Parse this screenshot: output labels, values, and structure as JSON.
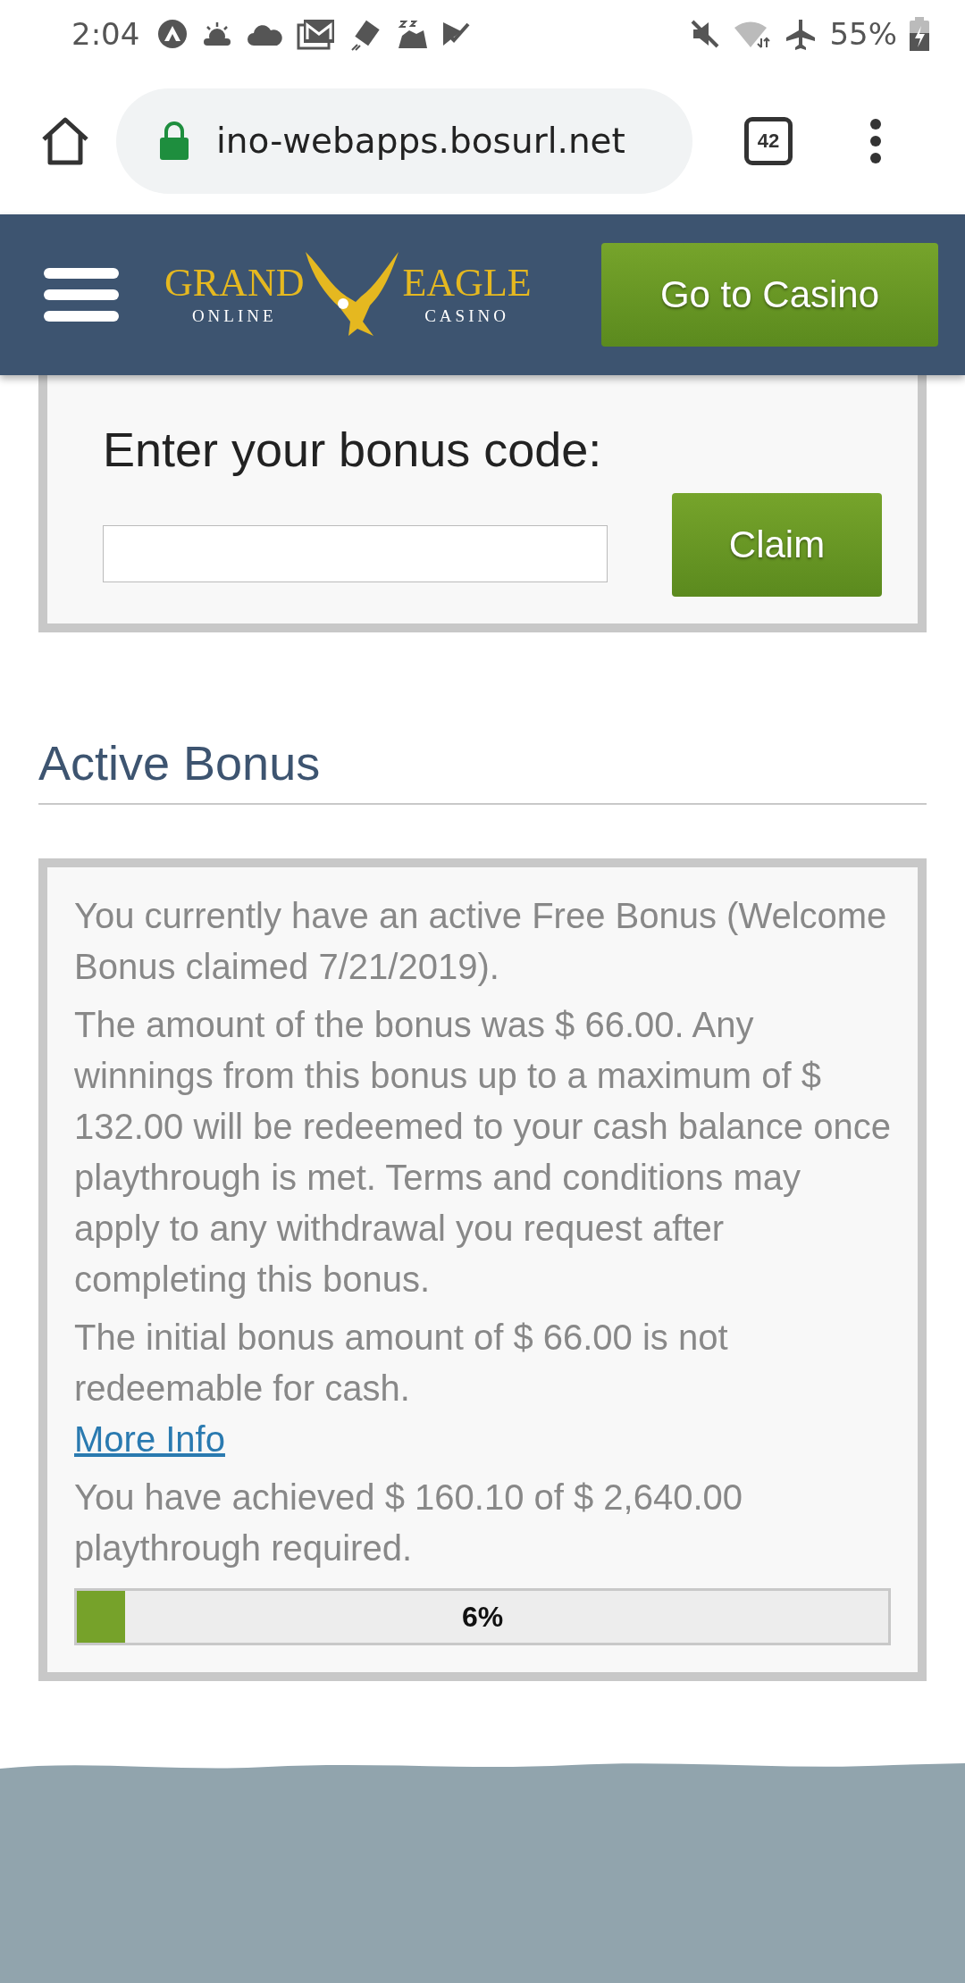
{
  "status_bar": {
    "time": "2:04",
    "battery": "55%"
  },
  "browser": {
    "url": "ino-webapps.bosurl.net",
    "tab_count": "42"
  },
  "header": {
    "logo": {
      "word_1": "GRAND",
      "word_2": "EAGLE",
      "sub_1": "ONLINE",
      "sub_2": "CASINO"
    },
    "button": "Go to Casino"
  },
  "bonus_code": {
    "title": "Enter your bonus code:",
    "button": "Claim"
  },
  "active_bonus": {
    "heading": "Active Bonus",
    "paragraphs": [
      {
        "kind": "text",
        "text": "You currently have an active Free Bonus (Welcome Bonus claimed 7/21/2019)."
      },
      {
        "kind": "text",
        "text": "The amount of the bonus was $ 66.00. Any winnings from this bonus up to a maximum of $ 132.00 will be redeemed to your cash balance once playthrough is met. Terms and conditions may apply to any withdrawal you request after completing this bonus."
      },
      {
        "kind": "text",
        "text": "The initial bonus amount of $ 66.00 is not redeemable for cash."
      },
      {
        "kind": "link",
        "text": "More Info"
      },
      {
        "kind": "text",
        "text": "You have achieved $ 160.10 of $ 2,640.00 playthrough required."
      }
    ],
    "progress": {
      "level": 0.06,
      "label": "6%"
    }
  }
}
